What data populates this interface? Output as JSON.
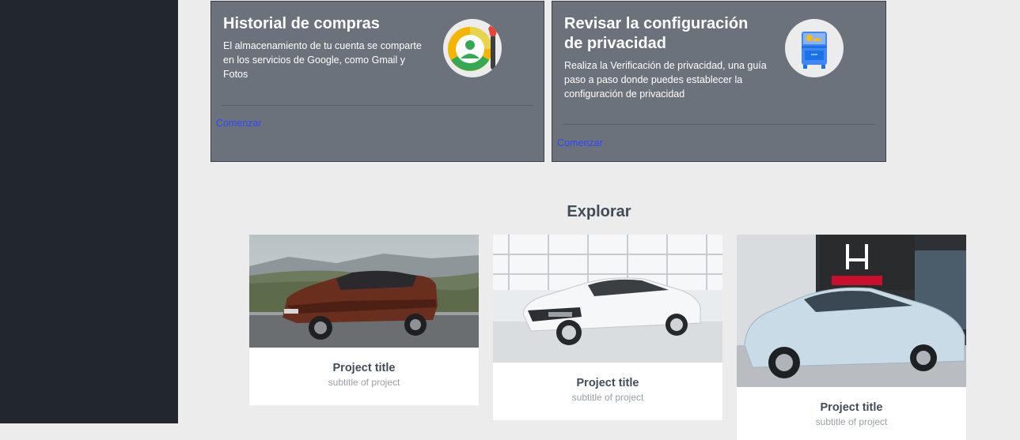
{
  "cards": [
    {
      "title": "Historial de compras",
      "description": "El almacenamiento de tu cuenta se comparte en los servicios de Google, como Gmail y Fotos",
      "link": "Comenzar",
      "icon": "purchase-history-icon"
    },
    {
      "title": "Revisar la configuración de privacidad",
      "description": "Realiza la Verificación de privacidad, una guía paso a paso donde puedes establecer la configuración de privacidad",
      "link": "Comenzar",
      "icon": "privacy-checkup-icon"
    }
  ],
  "explore": {
    "title": "Explorar",
    "projects": [
      {
        "title": "Project title",
        "subtitle": "subtitle of project",
        "image": "brown-suv-photo"
      },
      {
        "title": "Project title",
        "subtitle": "subtitle of project",
        "image": "white-sedan-photo"
      },
      {
        "title": "Project title",
        "subtitle": "subtitle of project",
        "image": "silver-honda-sedan-photo"
      }
    ]
  },
  "colors": {
    "sidebar": "#22272e",
    "background": "#ececec",
    "card": "#6c727b",
    "link": "#2f47ff",
    "heading": "#414c59"
  }
}
